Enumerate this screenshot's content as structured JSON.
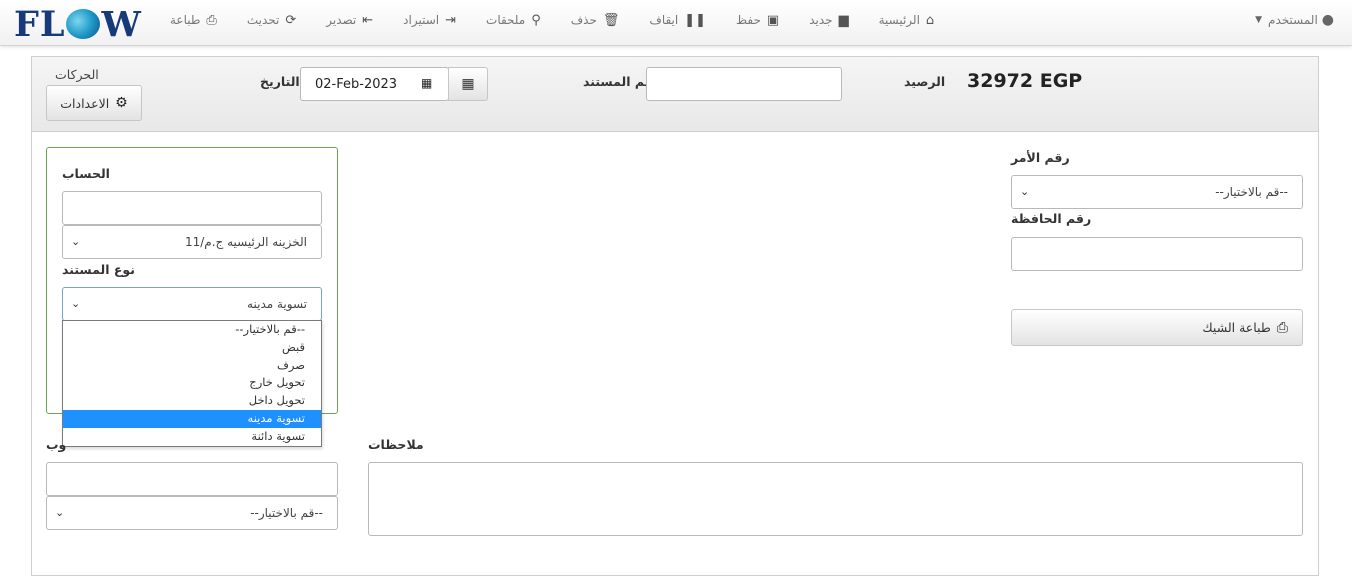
{
  "nav": {
    "logo": {
      "pre": "FL",
      "post": "W"
    },
    "items": [
      {
        "label": "الرئيسية",
        "icon": "home-icon",
        "glyph": "⌂"
      },
      {
        "label": "جديد",
        "icon": "file-icon",
        "glyph": "▆"
      },
      {
        "label": "حفظ",
        "icon": "save-icon",
        "glyph": "▣"
      },
      {
        "label": "ايقاف",
        "icon": "pause-icon",
        "glyph": "❚❚"
      },
      {
        "label": "حذف",
        "icon": "trash-icon",
        "glyph": "🗑"
      },
      {
        "label": "ملحقات",
        "icon": "paperclip-icon",
        "glyph": "⚲"
      },
      {
        "label": "استيراد",
        "icon": "import-icon",
        "glyph": "⇥"
      },
      {
        "label": "تصدير",
        "icon": "export-icon",
        "glyph": "⇤"
      },
      {
        "label": "تحديث",
        "icon": "refresh-icon",
        "glyph": "⟳"
      },
      {
        "label": "طباعة",
        "icon": "print-icon",
        "glyph": "⎙"
      }
    ],
    "user": {
      "label": "المستخدم",
      "icon": "user-icon",
      "glyph": "●"
    }
  },
  "header": {
    "movements_label": "الحركات",
    "settings_label": "الاعدادات",
    "date_label": "التاريخ",
    "date_value": "02-Feb-2023",
    "doc_number_label": "رقم المستند",
    "doc_number_value": "",
    "balance_label": "الرصيد",
    "balance_value": "32972 EGP"
  },
  "account": {
    "label": "الحساب",
    "input_value": "",
    "select_value": "الخزينه الرئيسيه ج.م/11"
  },
  "doc_type": {
    "label": "نوع المستند",
    "selected": "تسوية مدينه",
    "options": [
      "--قم بالاختيار--",
      "قبض",
      "صرف",
      "تحويل خارج",
      "تحويل داخل",
      "تسوية مدينه",
      "تسوية دائنة"
    ],
    "selected_index": 5
  },
  "order": {
    "label": "رقم الأمر",
    "select_value": "--قم بالاختيار--"
  },
  "wallet": {
    "label": "رقم الحافظة",
    "value": ""
  },
  "print_check": {
    "label": "طباعة الشيك"
  },
  "notes": {
    "label": "ملاحظات",
    "value": ""
  },
  "rep": {
    "label_partial": "وب",
    "input_value": "",
    "select_value": "--قم بالاختيار--"
  }
}
